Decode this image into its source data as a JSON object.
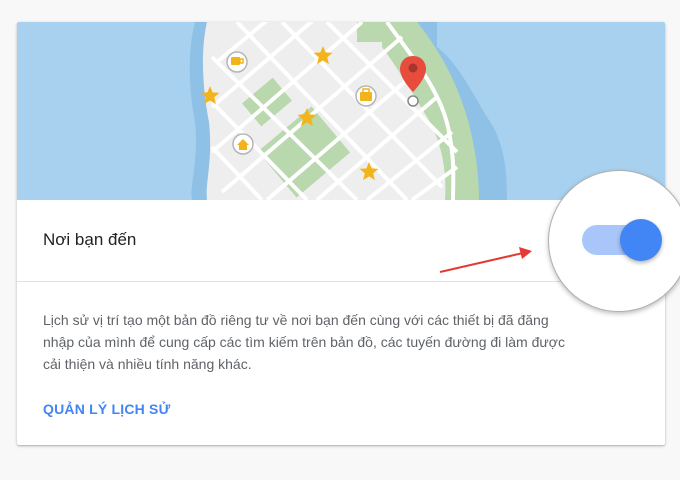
{
  "setting": {
    "title": "Nơi bạn đến",
    "description": "Lịch sử vị trí tạo một bản đồ riêng tư về nơi bạn đến cùng với các thiết bị đã đăng nhập của mình để cung cấp các tìm kiếm trên bản đồ, các tuyến đường đi làm được cải thiện và nhiều tính năng khác.",
    "manage_link": "QUẢN LÝ LỊCH SỬ",
    "toggle_state": "on"
  },
  "map": {
    "icons": [
      "coffee-marker-icon",
      "shop-marker-icon",
      "home-marker-icon",
      "star-icon",
      "location-pin-icon"
    ]
  },
  "colors": {
    "accent": "#4285f4",
    "toggle_track": "#a8c6f9",
    "water": "#a8d1ef",
    "land": "#eeeeee",
    "park": "#b9d8ad",
    "star": "#f2b31b",
    "pin": "#e74c3c",
    "arrow": "#e53935"
  }
}
